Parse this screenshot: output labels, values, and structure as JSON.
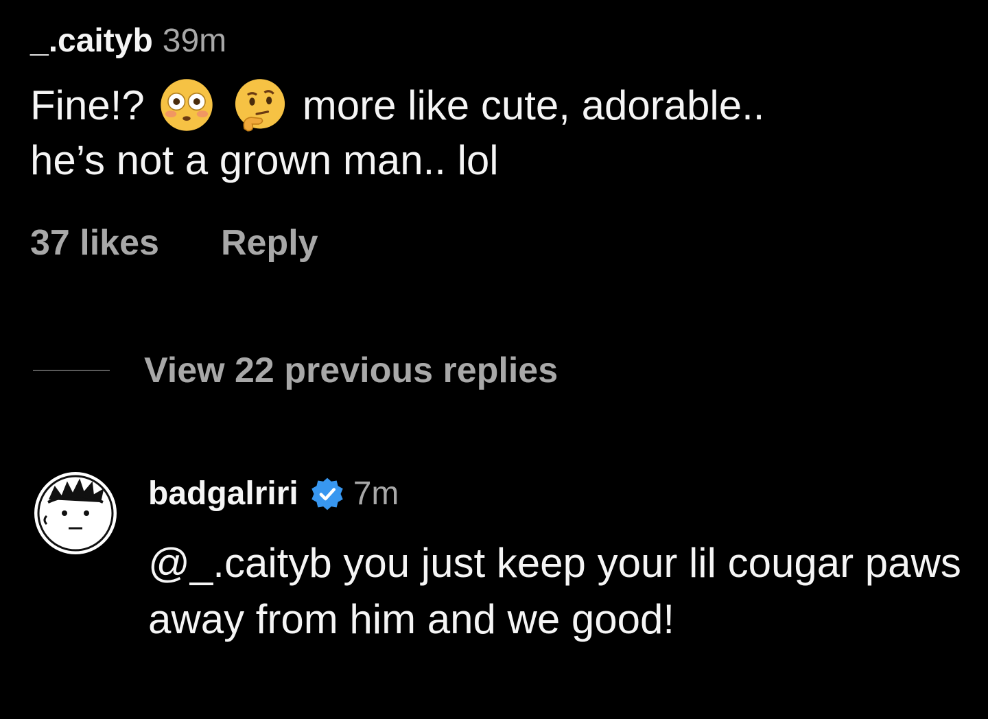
{
  "comment": {
    "username": "_.caityb",
    "time": "39m",
    "text_before_emoji": "Fine!?",
    "emojis": [
      "flushed-face-icon",
      "thinking-face-icon"
    ],
    "text_after_emoji": "more like cute, adorable..",
    "text_line2": "he’s not a grown man.. lol",
    "likes": "37 likes",
    "reply_label": "Reply"
  },
  "thread": {
    "view_replies_label": "View 22 previous replies"
  },
  "reply": {
    "username": "badgalriri",
    "verified": true,
    "time": "7m",
    "text": "@_.caityb you just keep your lil cougar paws away from him and we good!"
  },
  "colors": {
    "background": "#000000",
    "primary_text": "#f5f5f5",
    "secondary_text": "#a8a8a8",
    "verified_blue": "#3897f0"
  }
}
